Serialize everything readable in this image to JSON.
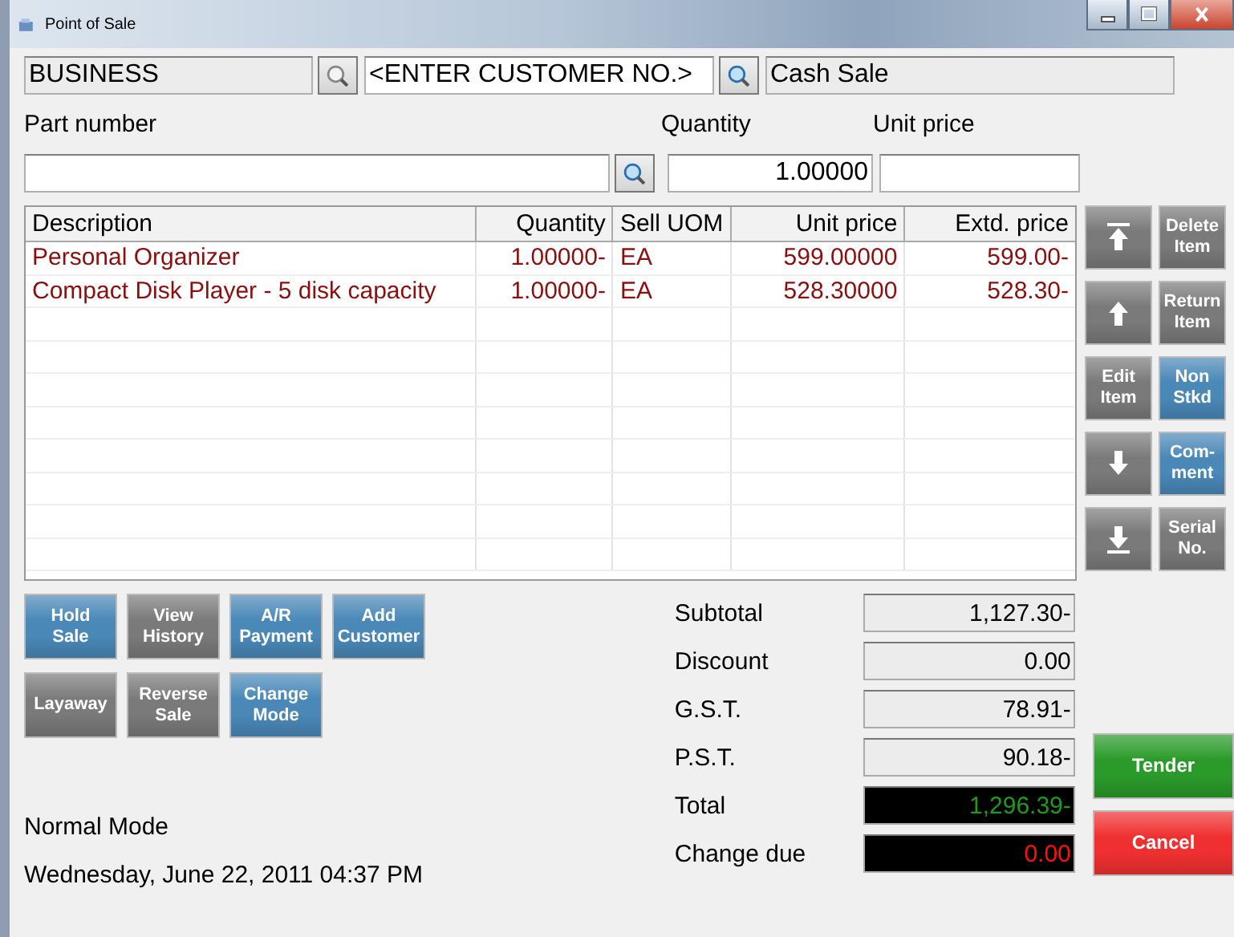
{
  "window": {
    "title": "Point of Sale"
  },
  "header": {
    "account": "BUSINESS",
    "customer": "<ENTER CUSTOMER NO.>",
    "customer_name": "Cash Sale"
  },
  "entry": {
    "part_label": "Part number",
    "quantity_label": "Quantity",
    "price_label": "Unit price",
    "quantity": "1.00000"
  },
  "table": {
    "columns": [
      "Description",
      "Quantity",
      "Sell UOM",
      "Unit price",
      "Extd. price"
    ],
    "rows": [
      [
        "Personal Organizer",
        "1.00000-",
        "EA",
        "599.00000",
        "599.00-"
      ],
      [
        "Compact Disk Player - 5 disk capacity",
        "1.00000-",
        "EA",
        "528.30000",
        "528.30-"
      ]
    ]
  },
  "side_buttons": [
    {
      "kind": "arrow",
      "color": "#7a7a7a"
    },
    {
      "kind": "text",
      "label": "Delete Item",
      "color": "#7a7a7a"
    },
    {
      "kind": "arrow",
      "color": "#7a7a7a"
    },
    {
      "kind": "text",
      "label": "Return Item",
      "color": "#7a7a7a"
    },
    {
      "kind": "text",
      "label": "Edit Item",
      "color": "#7a7a7a"
    },
    {
      "kind": "text",
      "label": "Non Stkd",
      "color": "#4a88b8"
    },
    {
      "kind": "arrow",
      "color": "#7a7a7a"
    },
    {
      "kind": "text",
      "label": "Com-ment",
      "color": "#4a88b8"
    },
    {
      "kind": "arrow",
      "color": "#7a7a7a"
    },
    {
      "kind": "text",
      "label": "Serial No.",
      "color": "#7a7a7a"
    }
  ],
  "action_buttons": [
    [
      {
        "label": "Hold Sale",
        "color": "#4a88b8"
      },
      {
        "label": "View History",
        "color": "#7a7a7a"
      },
      {
        "label": "A/R Payment",
        "color": "#4a88b8"
      },
      {
        "label": "Add Customer",
        "color": "#4a88b8"
      }
    ],
    [
      {
        "label": "Layaway",
        "color": "#7a7a7a"
      },
      {
        "label": "Reverse Sale",
        "color": "#7a7a7a"
      },
      {
        "label": "Change Mode",
        "color": "#4a88b8"
      }
    ]
  ],
  "status": {
    "mode": "Normal Mode",
    "datetime": "Wednesday, June 22, 2011 04:37 PM"
  },
  "totals": [
    {
      "label": "Subtotal",
      "value": "1,127.30-",
      "kind": "plain"
    },
    {
      "label": "Discount",
      "value": "0.00",
      "kind": "plain"
    },
    {
      "label": "G.S.T.",
      "value": "78.91-",
      "kind": "plain"
    },
    {
      "label": "P.S.T.",
      "value": "90.18-",
      "kind": "plain"
    },
    {
      "label": "Total",
      "value": "1,296.39-",
      "kind": "total"
    },
    {
      "label": "Change due",
      "value": "0.00",
      "kind": "change"
    }
  ],
  "final_buttons": [
    {
      "label": "Tender",
      "color": "#2a9a2a"
    },
    {
      "label": "Cancel",
      "color": "#f03030"
    }
  ]
}
